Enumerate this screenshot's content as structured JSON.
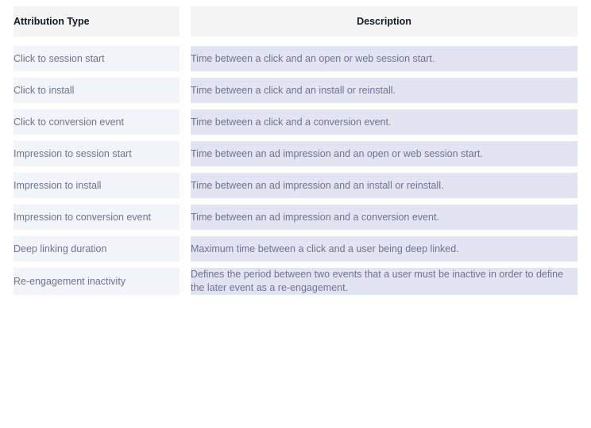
{
  "table": {
    "name": "attribution-type-table",
    "columns": [
      {
        "key": "type",
        "label": "Attribution Type",
        "align": "left"
      },
      {
        "key": "description",
        "label": "Description",
        "align": "center"
      }
    ],
    "rows": [
      {
        "type": "Click to session start",
        "description": "Time between a click and an open or web session start."
      },
      {
        "type": "Click to install",
        "description": "Time between a click and an install or reinstall."
      },
      {
        "type": "Click to conversion event",
        "description": "Time between a click and a conversion event."
      },
      {
        "type": "Impression to session start",
        "description": "Time between an ad impression and an open or web session start."
      },
      {
        "type": "Impression to install",
        "description": "Time between an ad impression and an install or reinstall."
      },
      {
        "type": "Impression to conversion event",
        "description": "Time between an ad impression and a conversion event."
      },
      {
        "type": "Deep linking duration",
        "description": "Maximum time between a click and a user being deep linked."
      },
      {
        "type": "Re-engagement inactivity",
        "description": "Defines the period between two events that a user must be inactive in order to define the later event as a re-engagement."
      }
    ]
  },
  "colors": {
    "page_background": "#ffffff",
    "header_background": "#f4f4f4",
    "header_text": "#1a1a2b",
    "type_cell_background": "#f3f4fa",
    "description_cell_background": "#e2e4f1",
    "body_text": "#6f7394"
  }
}
